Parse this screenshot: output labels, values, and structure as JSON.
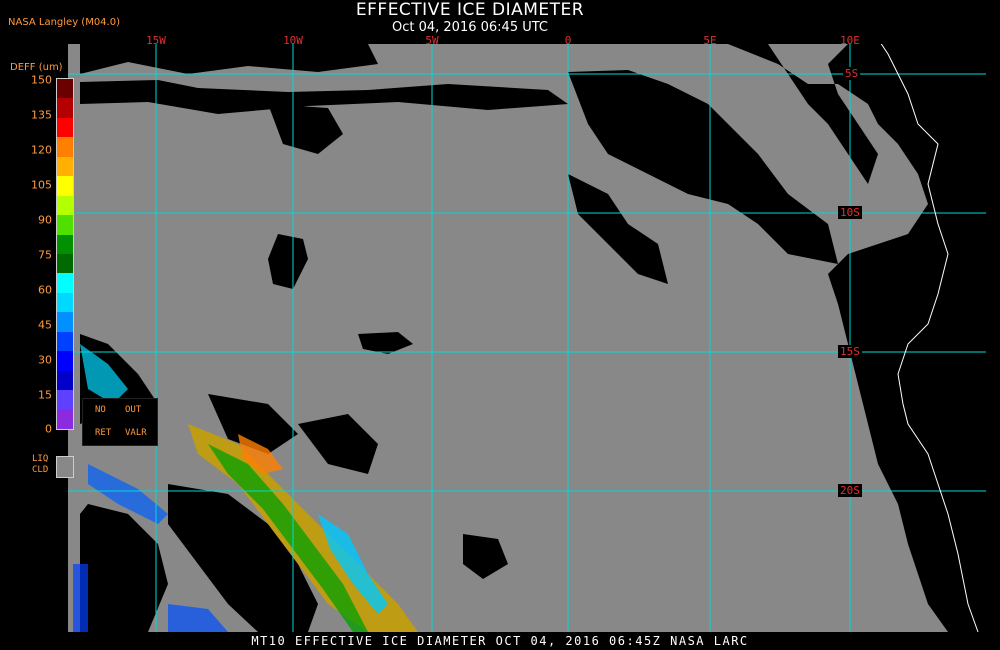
{
  "header": {
    "title": "EFFECTIVE ICE DIAMETER",
    "subtitle": "Oct 04, 2016 06:45 UTC",
    "provider": "NASA Langley (M04.0)"
  },
  "map": {
    "longitude_labels": [
      "15W",
      "10W",
      "5W",
      "0",
      "5E",
      "10E"
    ],
    "latitude_labels": [
      "5S",
      "10S",
      "15S",
      "20S"
    ],
    "colors": {
      "background": "#000000",
      "liquid_cloud": "#888888",
      "grid": "#00d8d8",
      "coastline": "#ffffff",
      "grid_label": "#e03030"
    }
  },
  "colorbar": {
    "title": "DEFF (um)",
    "ticks": [
      "150",
      "135",
      "120",
      "105",
      "90",
      "75",
      "60",
      "45",
      "30",
      "15",
      "0"
    ],
    "segments": [
      "#6b0000",
      "#b40000",
      "#ff0000",
      "#ff7f00",
      "#ffb000",
      "#ffff00",
      "#b4ff00",
      "#50e000",
      "#009000",
      "#006a00",
      "#00ffff",
      "#00d8ff",
      "#0090ff",
      "#0040ff",
      "#0000ff",
      "#0000c8",
      "#6040ff",
      "#8a2be2"
    ],
    "legend": {
      "no_ret": [
        "NO",
        "RET"
      ],
      "out_valr": [
        "OUT",
        "VALR"
      ]
    },
    "liq_cld": [
      "LIQ",
      "CLD"
    ]
  },
  "footer": {
    "text": "MT10  EFFECTIVE ICE DIAMETER   OCT 04, 2016 06:45Z   NASA LARC"
  }
}
